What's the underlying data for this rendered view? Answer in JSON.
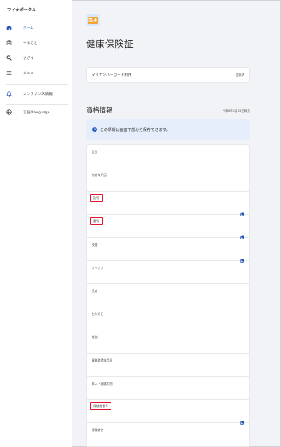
{
  "app_title": "マイナポータル",
  "sidebar": {
    "items": [
      {
        "label": "ホーム",
        "icon": "home-icon",
        "active": true
      },
      {
        "label": "やること",
        "icon": "clipboard-icon",
        "active": false
      },
      {
        "label": "さがす",
        "icon": "search-icon",
        "active": false
      },
      {
        "label": "メニュー",
        "icon": "menu-icon",
        "active": false
      },
      {
        "label": "メンテナンス情報",
        "icon": "bell-icon",
        "active": false
      },
      {
        "label": "言語/Language",
        "icon": "globe-icon",
        "active": false
      }
    ]
  },
  "page": {
    "title": "健康保険証",
    "mynumber_card_label": "マイナンバーカード利用",
    "mynumber_card_status": "登録済"
  },
  "section": {
    "title": "資格情報",
    "date": "令和6年1月23日時点",
    "info_banner": "この情報は画面下部から保存できます。"
  },
  "fields": [
    {
      "label": "区分",
      "highlight": false,
      "copy": false
    },
    {
      "label": "交付年月日",
      "highlight": false,
      "copy": false
    },
    {
      "label": "記号",
      "highlight": true,
      "copy": true
    },
    {
      "label": "番号",
      "highlight": true,
      "copy": true
    },
    {
      "label": "枝番",
      "highlight": false,
      "copy": true
    },
    {
      "label": "フリガナ",
      "highlight": false,
      "copy": false
    },
    {
      "label": "氏名",
      "highlight": false,
      "copy": false
    },
    {
      "label": "生年月日",
      "highlight": false,
      "copy": false
    },
    {
      "label": "性別",
      "highlight": false,
      "copy": false
    },
    {
      "label": "資格取得年月日",
      "highlight": false,
      "copy": false
    },
    {
      "label": "本人・家族の別",
      "highlight": false,
      "copy": false
    },
    {
      "label": "保険者番号",
      "highlight": true,
      "copy": true
    },
    {
      "label": "保険者名",
      "highlight": false,
      "copy": false
    }
  ],
  "colors": {
    "accent": "#2356b8",
    "highlight_border": "#e0182d",
    "info_bg": "#e6eefb"
  }
}
